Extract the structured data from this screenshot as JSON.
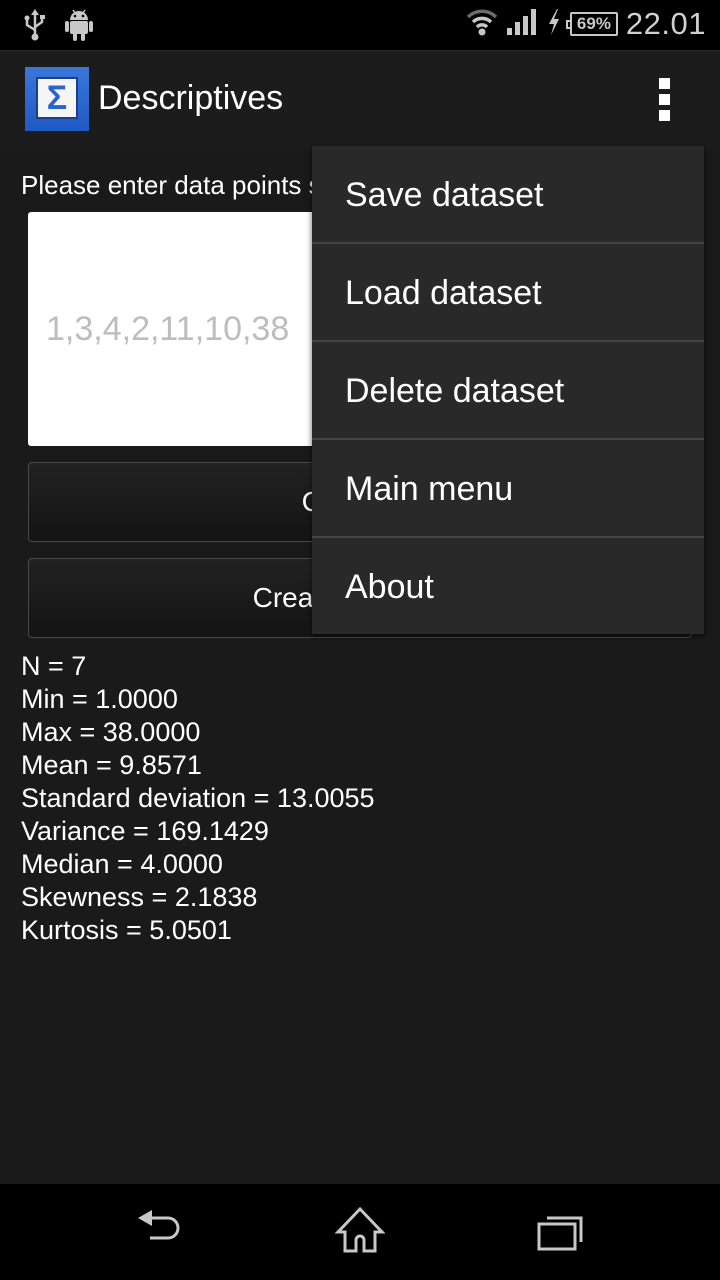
{
  "status_bar": {
    "left_icons": [
      "usb-icon",
      "android-debug-icon"
    ],
    "right_icons": [
      "wifi-icon",
      "signal-icon",
      "charging-icon",
      "battery-icon"
    ],
    "battery_percent": "69%",
    "time": "22.01"
  },
  "action_bar": {
    "app_icon_glyph": "Σ",
    "title": "Descriptives",
    "overflow_icon": "more-vert-icon"
  },
  "main": {
    "prompt": "Please enter data points separated by commas",
    "data_input": {
      "value": "",
      "placeholder": "1,3,4,2,11,10,38"
    },
    "calculate_button": "Calculate",
    "create_button": "Create histogram",
    "results": [
      "N = 7",
      "Min = 1.0000",
      "Max = 38.0000",
      "Mean = 9.8571",
      "Standard deviation = 13.0055",
      "Variance = 169.1429",
      "Median = 4.0000",
      "Skewness = 2.1838",
      "Kurtosis = 5.0501"
    ]
  },
  "overflow_menu": {
    "items": [
      {
        "label": "Save dataset"
      },
      {
        "label": "Load dataset"
      },
      {
        "label": "Delete dataset"
      },
      {
        "label": "Main menu"
      },
      {
        "label": "About"
      }
    ]
  },
  "nav_bar": {
    "buttons": [
      "back-icon",
      "home-icon",
      "recents-icon"
    ]
  }
}
